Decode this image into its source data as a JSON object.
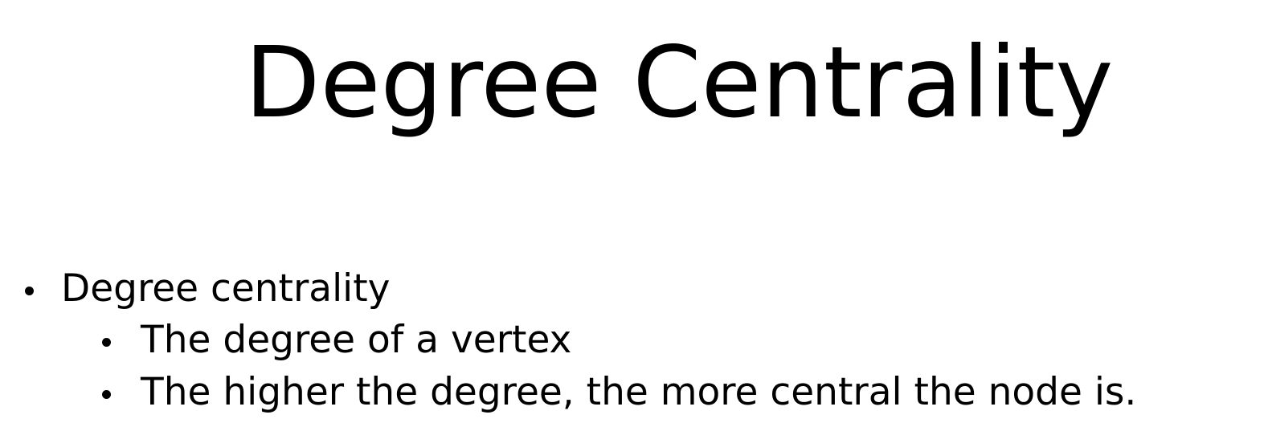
{
  "slide": {
    "title": "Degree Centrality",
    "bullets": [
      {
        "text": "Degree centrality",
        "children": [
          {
            "text": "The degree of a vertex"
          },
          {
            "text": "The higher the degree, the more central the node is."
          }
        ]
      }
    ]
  }
}
